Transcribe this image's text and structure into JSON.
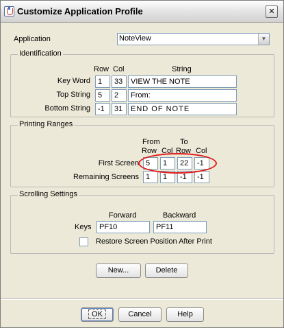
{
  "window": {
    "title": "Customize Application Profile",
    "close_glyph": "✕"
  },
  "application": {
    "label": "Application",
    "value": "NoteView",
    "arrow_glyph": "▼"
  },
  "identification": {
    "title": "Identification",
    "headers": {
      "row": "Row",
      "col": "Col",
      "string": "String"
    },
    "rows": [
      {
        "label": "Key Word",
        "row": "1",
        "col": "33",
        "string": "VIEW THE NOTE"
      },
      {
        "label": "Top String",
        "row": "5",
        "col": "2",
        "string": "From:"
      },
      {
        "label": "Bottom String",
        "row": "-1",
        "col": "31",
        "string": "END OF NOTE"
      }
    ]
  },
  "printing": {
    "title": "Printing Ranges",
    "headers": {
      "from": "From",
      "to": "To",
      "row": "Row",
      "col": "Col"
    },
    "rows": [
      {
        "label": "First Screen",
        "from_row": "5",
        "from_col": "1",
        "to_row": "22",
        "to_col": "-1"
      },
      {
        "label": "Remaining Screens",
        "from_row": "1",
        "from_col": "1",
        "to_row": "-1",
        "to_col": "-1"
      }
    ]
  },
  "scrolling": {
    "title": "Scrolling Settings",
    "forward_label": "Forward",
    "backward_label": "Backward",
    "keys_label": "Keys",
    "forward_value": "PF10",
    "backward_value": "PF11",
    "restore_label": "Restore Screen Position After Print",
    "restore_checked": false
  },
  "actions": {
    "new": "New...",
    "delete": "Delete"
  },
  "footer": {
    "ok": "OK",
    "cancel": "Cancel",
    "help": "Help"
  },
  "colors": {
    "annotation": "#e01818"
  }
}
